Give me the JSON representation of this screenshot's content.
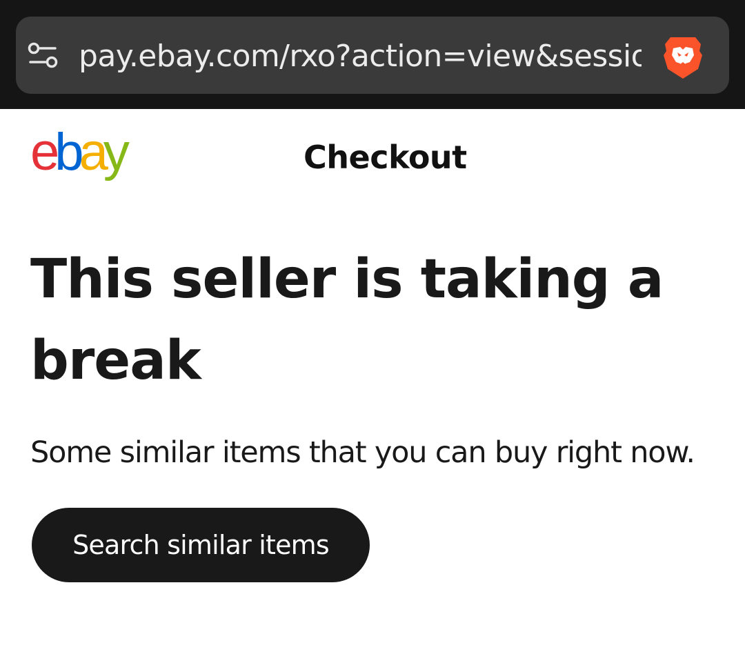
{
  "browser": {
    "url": "pay.ebay.com/rxo?action=view&sessionid",
    "site_settings_icon": "site-settings-icon",
    "shield_icon": "brave-shields-icon",
    "bar_color": "#151515",
    "pill_color": "#3a3a3a"
  },
  "header": {
    "logo_text": "ebay",
    "logo_colors": [
      "#e53238",
      "#0064d2",
      "#f5af02",
      "#86b817"
    ],
    "title": "Checkout"
  },
  "main": {
    "headline": "This seller is taking a break",
    "subtext": "Some similar items that you can buy right now.",
    "search_button_label": "Search similar items",
    "button_color": "#191919"
  }
}
